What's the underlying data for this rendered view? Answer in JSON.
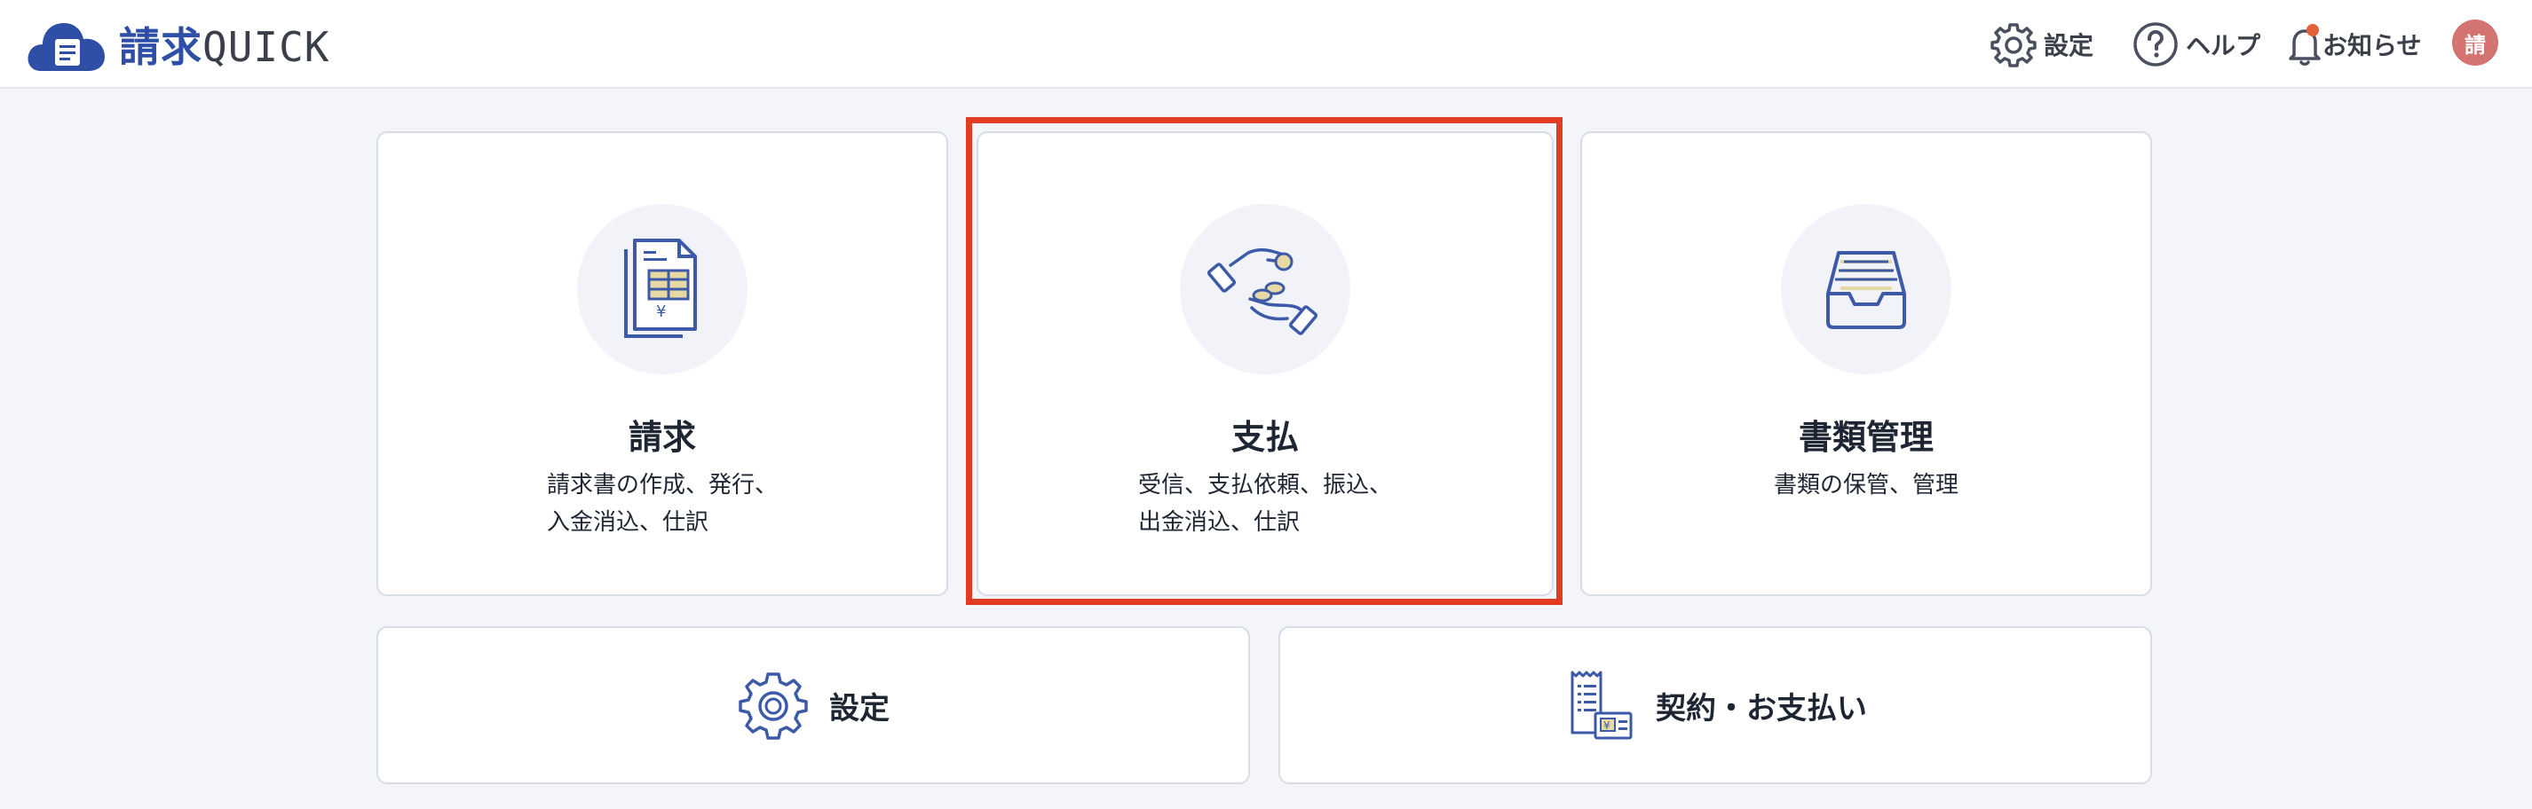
{
  "header": {
    "logo": {
      "name": "請求",
      "suffix": "QUICK"
    },
    "nav": {
      "settings_label": "設定",
      "help_label": "ヘルプ",
      "notice_label": "お知らせ"
    },
    "avatar_initial": "請"
  },
  "cards": [
    {
      "title": "請求",
      "desc_line1": "請求書の作成、発行、",
      "desc_line2": "入金消込、仕訳",
      "icon": "invoice-document-icon"
    },
    {
      "title": "支払",
      "desc_line1": "受信、支払依頼、振込、",
      "desc_line2": "出金消込、仕訳",
      "icon": "payment-hands-coins-icon",
      "highlighted": true
    },
    {
      "title": "書類管理",
      "desc_line1": "書類の保管、管理",
      "desc_line2": "",
      "icon": "document-tray-icon"
    }
  ],
  "bottom_cards": [
    {
      "label": "設定",
      "icon": "gear-icon"
    },
    {
      "label": "契約・お支払い",
      "icon": "receipt-contract-icon"
    }
  ],
  "colors": {
    "brand": "#2f4fa6",
    "highlight": "#e23c22",
    "avatar": "#d47470",
    "notification_dot": "#e0623a",
    "icon_accent": "#e8d9a4"
  }
}
